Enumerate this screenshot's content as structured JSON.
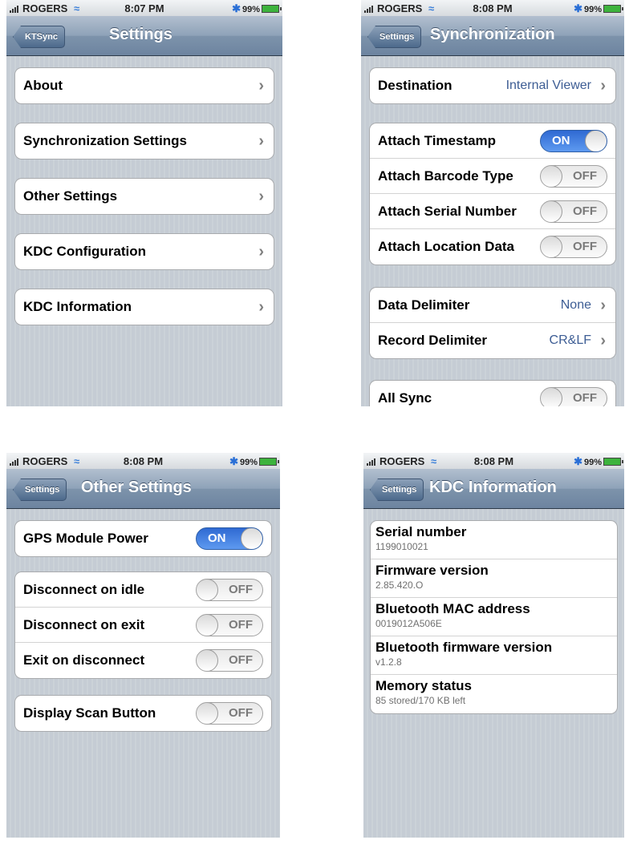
{
  "status_bar": {
    "screen1": {
      "carrier": "ROGERS",
      "time": "8:07 PM",
      "battery": "99%"
    },
    "screen2": {
      "carrier": "ROGERS",
      "time": "8:08 PM",
      "battery": "99%"
    },
    "screen3": {
      "carrier": "ROGERS",
      "time": "8:08 PM",
      "battery": "99%"
    },
    "screen4": {
      "carrier": "ROGERS",
      "time": "8:08 PM",
      "battery": "99%"
    }
  },
  "screen1": {
    "back": "KTSync",
    "title": "Settings",
    "items": [
      "About",
      "Synchronization Settings",
      "Other Settings",
      "KDC Configuration",
      "KDC Information"
    ]
  },
  "screen2": {
    "back": "Settings",
    "title": "Synchronization",
    "destination": {
      "label": "Destination",
      "value": "Internal Viewer"
    },
    "toggles": [
      {
        "label": "Attach Timestamp",
        "state": "ON"
      },
      {
        "label": "Attach Barcode Type",
        "state": "OFF"
      },
      {
        "label": "Attach Serial Number",
        "state": "OFF"
      },
      {
        "label": "Attach Location Data",
        "state": "OFF"
      }
    ],
    "delimiters": [
      {
        "label": "Data Delimiter",
        "value": "None"
      },
      {
        "label": "Record Delimiter",
        "value": "CR&LF"
      }
    ],
    "all_sync": {
      "label": "All Sync",
      "state": "OFF"
    }
  },
  "screen3": {
    "back": "Settings",
    "title": "Other Settings",
    "gps": {
      "label": "GPS Module Power",
      "state": "ON"
    },
    "disconnect": [
      {
        "label": "Disconnect on idle",
        "state": "OFF"
      },
      {
        "label": "Disconnect on exit",
        "state": "OFF"
      },
      {
        "label": "Exit on disconnect",
        "state": "OFF"
      }
    ],
    "scan": {
      "label": "Display Scan Button",
      "state": "OFF"
    }
  },
  "screen4": {
    "back": "Settings",
    "title": "KDC Information",
    "rows": [
      {
        "title": "Serial number",
        "value": "1199010021"
      },
      {
        "title": "Firmware version",
        "value": "2.85.420.O"
      },
      {
        "title": "Bluetooth MAC address",
        "value": "0019012A506E"
      },
      {
        "title": "Bluetooth firmware version",
        "value": "v1.2.8"
      },
      {
        "title": "Memory status",
        "value": "85 stored/170 KB left"
      }
    ]
  },
  "colors": {
    "navbar": "#7d93ab",
    "toggle_on": "#3b7ae0",
    "detail_text": "#3d5d94"
  }
}
